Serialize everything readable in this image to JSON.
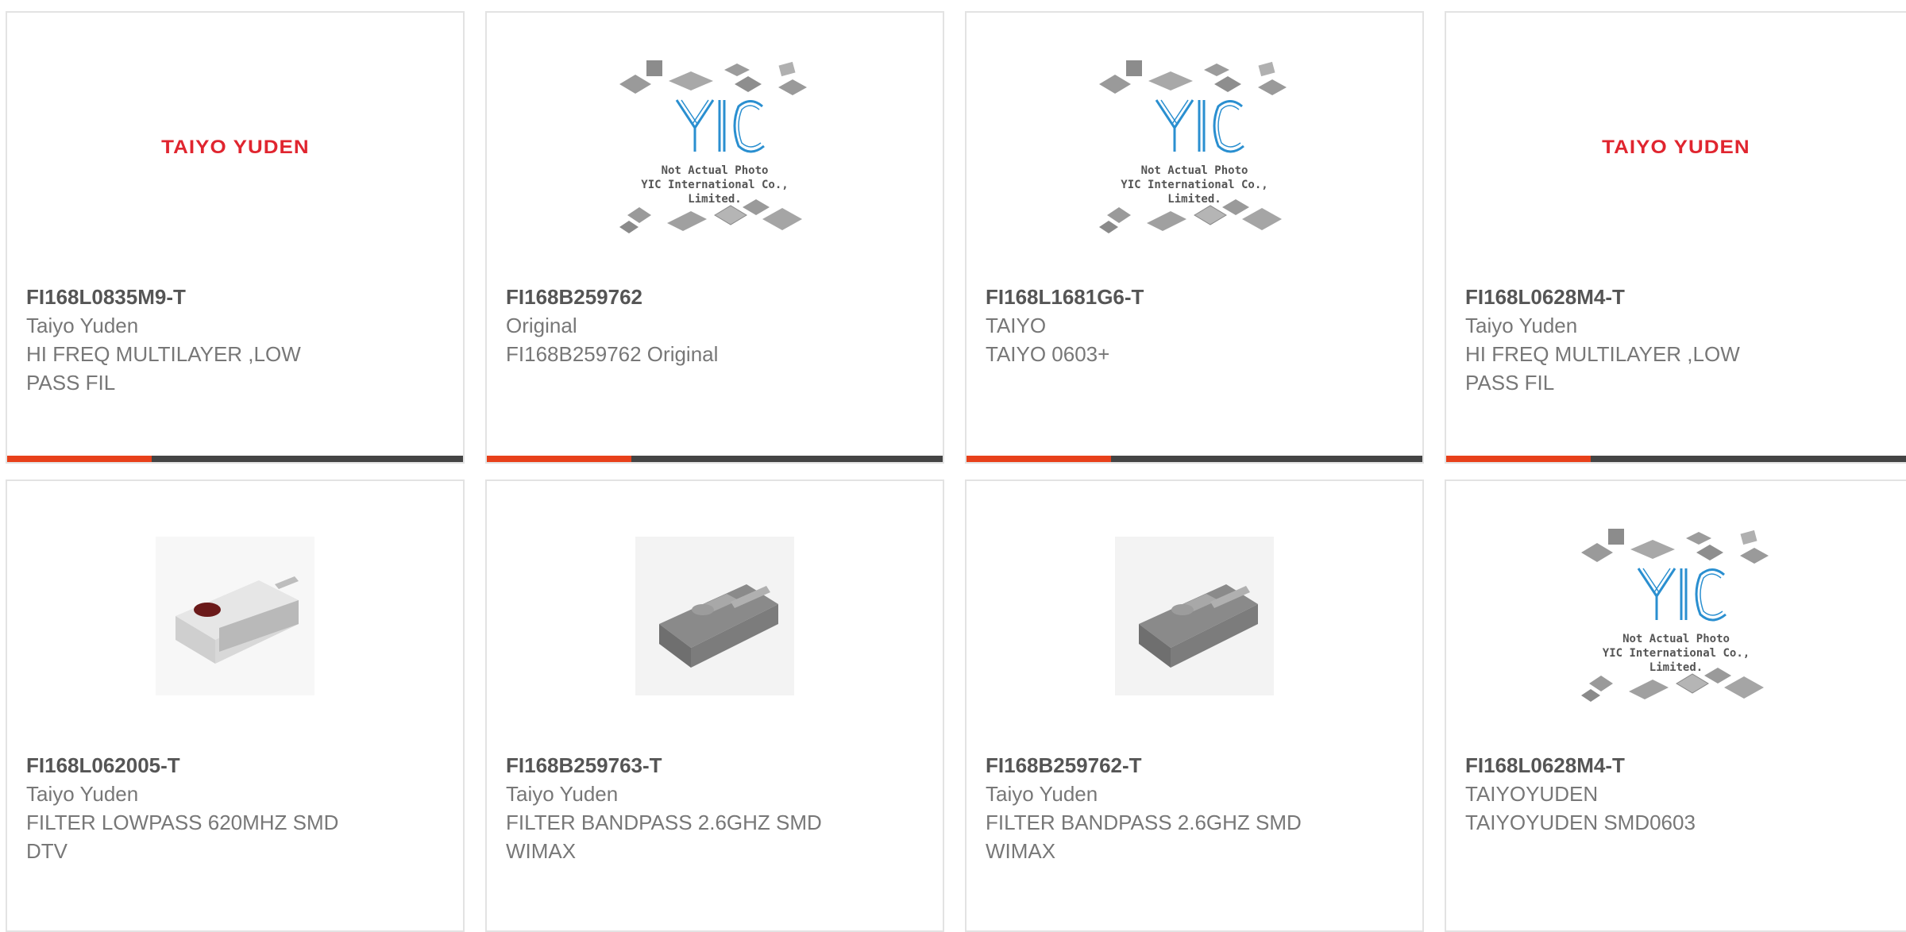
{
  "products": [
    {
      "part": "FI168L0835M9-T",
      "manufacturer": "Taiyo Yuden",
      "description": "HI FREQ MULTILAYER ,LOW PASS FIL",
      "image": "taiyo-yuden-logo",
      "logo_text": "TAIYO YUDEN"
    },
    {
      "part": "FI168B259762",
      "manufacturer": "Original",
      "description": "FI168B259762 Original",
      "image": "yic-not-actual-photo",
      "yic_line1": "Not Actual Photo",
      "yic_line2": "YIC International Co., Limited."
    },
    {
      "part": "FI168L1681G6-T",
      "manufacturer": "TAIYO",
      "description": "TAIYO 0603+",
      "image": "yic-not-actual-photo",
      "yic_line1": "Not Actual Photo",
      "yic_line2": "YIC International Co., Limited."
    },
    {
      "part": "FI168L0628M4-T",
      "manufacturer": "Taiyo Yuden",
      "description": "HI FREQ MULTILAYER ,LOW PASS FIL",
      "image": "taiyo-yuden-logo",
      "logo_text": "TAIYO YUDEN"
    },
    {
      "part": "FI168L062005-T",
      "manufacturer": "Taiyo Yuden",
      "description": "FILTER LOWPASS 620MHZ SMD DTV",
      "image": "white-smd-chip-photo"
    },
    {
      "part": "FI168B259763-T",
      "manufacturer": "Taiyo Yuden",
      "description": "FILTER BANDPASS 2.6GHZ SMD WIMAX",
      "image": "gray-smd-chip-photo"
    },
    {
      "part": "FI168B259762-T",
      "manufacturer": "Taiyo Yuden",
      "description": "FILTER BANDPASS 2.6GHZ SMD WIMAX",
      "image": "gray-smd-chip-photo"
    },
    {
      "part": "FI168L0628M4-T",
      "manufacturer": "TAIYOYUDEN",
      "description": "TAIYOYUDEN SMD0603",
      "image": "yic-not-actual-photo",
      "yic_line1": "Not Actual Photo",
      "yic_line2": "YIC International Co., Limited."
    }
  ],
  "colors": {
    "accent": "#e8401a",
    "bar": "#444444",
    "logo_red": "#e0252f",
    "yic_blue": "#2a8fd0"
  }
}
